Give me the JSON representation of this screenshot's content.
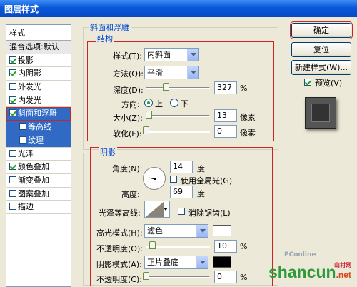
{
  "window": {
    "title": "图层样式"
  },
  "styles_panel": {
    "header": "样式",
    "blend_item": "混合选项:默认",
    "items": [
      {
        "label": "投影",
        "checked": true
      },
      {
        "label": "内阴影",
        "checked": true
      },
      {
        "label": "外发光",
        "checked": false
      },
      {
        "label": "内发光",
        "checked": true
      },
      {
        "label": "斜面和浮雕",
        "checked": true,
        "selected": true
      },
      {
        "label": "等高线",
        "checked": false,
        "sub": true
      },
      {
        "label": "纹理",
        "checked": false,
        "sub": true
      },
      {
        "label": "光泽",
        "checked": false
      },
      {
        "label": "颜色叠加",
        "checked": true
      },
      {
        "label": "渐变叠加",
        "checked": false
      },
      {
        "label": "图案叠加",
        "checked": false
      },
      {
        "label": "描边",
        "checked": false
      }
    ]
  },
  "bevel": {
    "group_title": "斜面和浮雕",
    "structure_title": "结构",
    "style_label": "样式(T):",
    "style_value": "内斜面",
    "technique_label": "方法(Q):",
    "technique_value": "平滑",
    "depth_label": "深度(D):",
    "depth_value": "327",
    "depth_unit": "%",
    "depth_level": 0.33,
    "direction_label": "方向:",
    "dir_up": "上",
    "dir_down": "下",
    "size_label": "大小(Z):",
    "size_value": "13",
    "size_unit": "像素",
    "size_level": 0.05,
    "soften_label": "软化(F):",
    "soften_value": "0",
    "soften_unit": "像素",
    "soften_level": 0
  },
  "shading": {
    "title": "阴影",
    "angle_label": "角度(N):",
    "angle_value": "14",
    "angle_unit": "度",
    "global_light_label": "使用全局光(G)",
    "altitude_label": "高度:",
    "altitude_value": "69",
    "altitude_unit": "度",
    "gloss_label": "光泽等高线:",
    "antialias_label": "消除锯齿(L)",
    "highlight_label": "高光模式(H):",
    "highlight_value": "滤色",
    "highlight_opacity_label": "不透明度(O):",
    "highlight_opacity_value": "10",
    "highlight_opacity_unit": "%",
    "highlight_opacity_level": 0.1,
    "shadow_label": "阴影模式(A):",
    "shadow_value": "正片叠底",
    "shadow_opacity_label": "不透明度(C):",
    "shadow_opacity_value": "0",
    "shadow_opacity_unit": "%",
    "shadow_opacity_level": 0,
    "highlight_color": "#ffffff",
    "shadow_color": "#000000"
  },
  "buttons": {
    "ok": "确定",
    "reset": "复位",
    "new_style": "新建样式(W)...",
    "preview": "预览(V)"
  },
  "watermark": {
    "site_small": "PConline",
    "brand": "shancun",
    "brand_suffix": ".net",
    "brand_sub": "山村网"
  }
}
